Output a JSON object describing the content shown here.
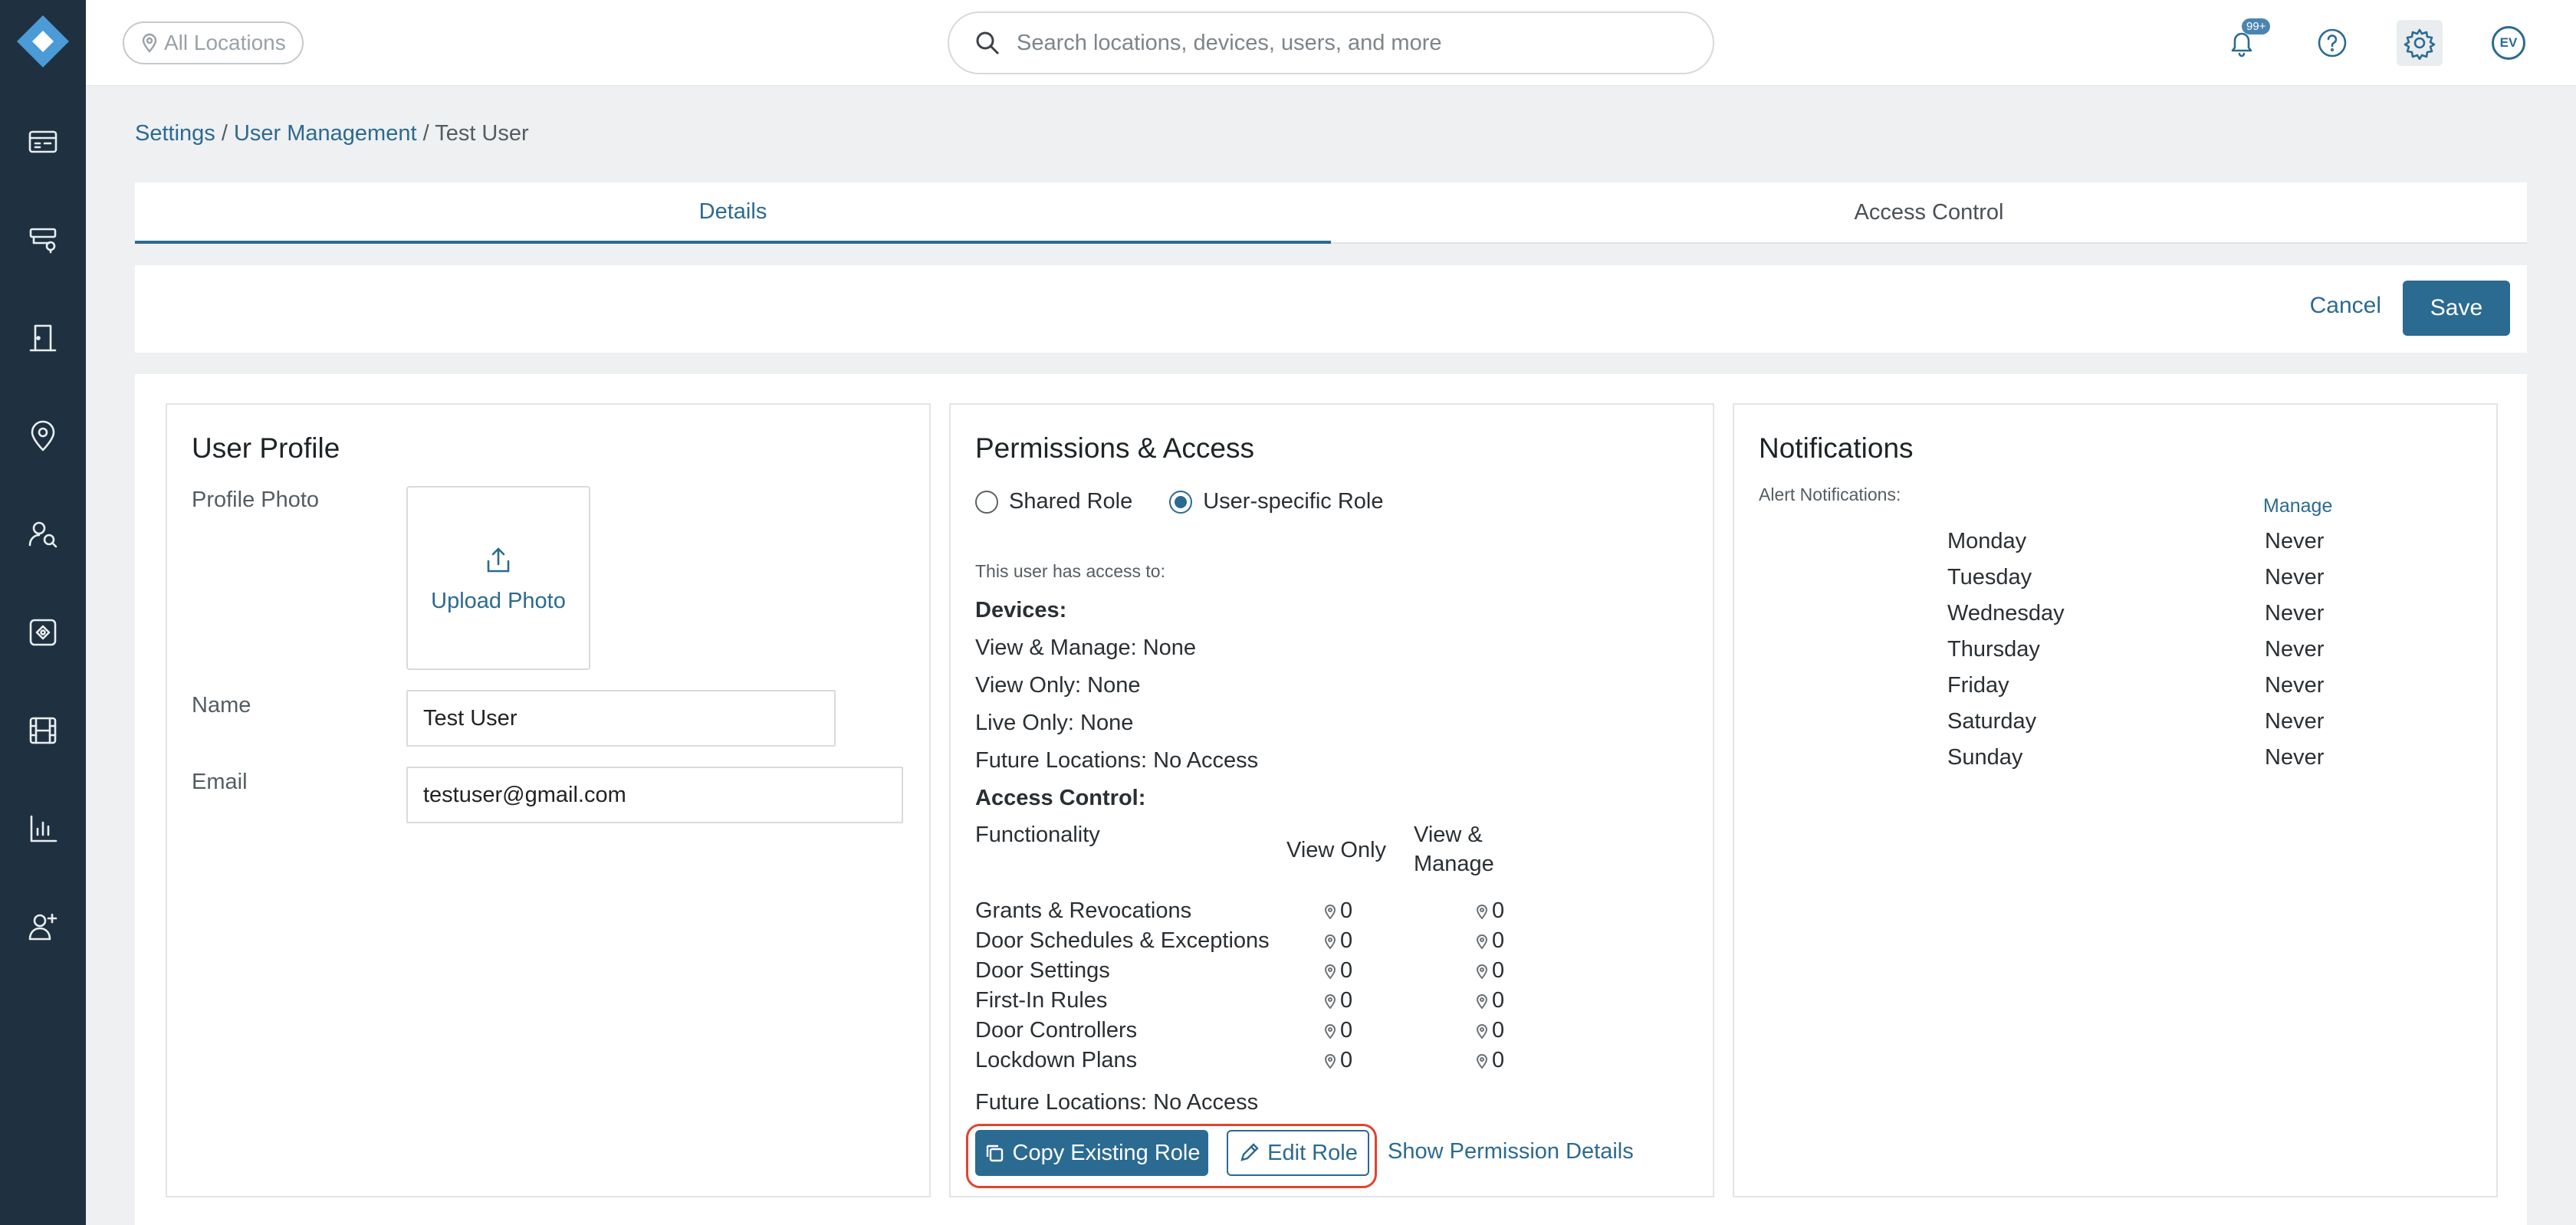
{
  "topbar": {
    "location_filter": "All Locations",
    "search_placeholder": "Search locations, devices, users, and more",
    "notification_badge": "99+",
    "avatar_initials": "EV"
  },
  "sidebar": {
    "icons": [
      "dashboard-icon",
      "devices-icon",
      "door-icon",
      "location-icon",
      "people-search-icon",
      "access-icon",
      "video-icon",
      "analytics-icon",
      "add-user-icon"
    ]
  },
  "breadcrumb": {
    "settings": "Settings",
    "separator": " / ",
    "user_management": "User Management",
    "current": "Test User"
  },
  "tabs": {
    "details": "Details",
    "access_control": "Access Control"
  },
  "actions": {
    "cancel": "Cancel",
    "save": "Save"
  },
  "profile": {
    "title": "User Profile",
    "photo_label": "Profile Photo",
    "upload_label": "Upload Photo",
    "name_label": "Name",
    "name_value": "Test User",
    "email_label": "Email",
    "email_value": "testuser@gmail.com"
  },
  "permissions": {
    "title": "Permissions & Access",
    "role_options": [
      "Shared Role",
      "User-specific Role"
    ],
    "selected_role": "User-specific Role",
    "intro": "This user has access to:",
    "devices_heading": "Devices:",
    "devices": [
      "View & Manage: None",
      "View Only: None",
      "Live Only: None",
      "Future Locations: No Access"
    ],
    "access_heading": "Access Control:",
    "functionality_header": "Functionality",
    "view_only_header": "View Only",
    "view_manage_header_1": "View &",
    "view_manage_header_2": "Manage",
    "rows": [
      {
        "name": "Grants & Revocations",
        "view_only": "0",
        "view_manage": "0"
      },
      {
        "name": "Door Schedules & Exceptions",
        "view_only": "0",
        "view_manage": "0"
      },
      {
        "name": "Door Settings",
        "view_only": "0",
        "view_manage": "0"
      },
      {
        "name": "First-In Rules",
        "view_only": "0",
        "view_manage": "0"
      },
      {
        "name": "Door Controllers",
        "view_only": "0",
        "view_manage": "0"
      },
      {
        "name": "Lockdown Plans",
        "view_only": "0",
        "view_manage": "0"
      }
    ],
    "future_locations": "Future Locations: No Access",
    "copy_role": "Copy Existing Role",
    "edit_role": "Edit Role",
    "show_details": "Show Permission Details"
  },
  "notifications": {
    "title": "Notifications",
    "alert_label": "Alert Notifications:",
    "manage": "Manage",
    "schedule": [
      {
        "day": "Monday",
        "value": "Never"
      },
      {
        "day": "Tuesday",
        "value": "Never"
      },
      {
        "day": "Wednesday",
        "value": "Never"
      },
      {
        "day": "Thursday",
        "value": "Never"
      },
      {
        "day": "Friday",
        "value": "Never"
      },
      {
        "day": "Saturday",
        "value": "Never"
      },
      {
        "day": "Sunday",
        "value": "Never"
      }
    ]
  },
  "colors": {
    "sidebar": "#1f3140",
    "accent": "#2b6a91",
    "highlight": "#e0442e"
  }
}
